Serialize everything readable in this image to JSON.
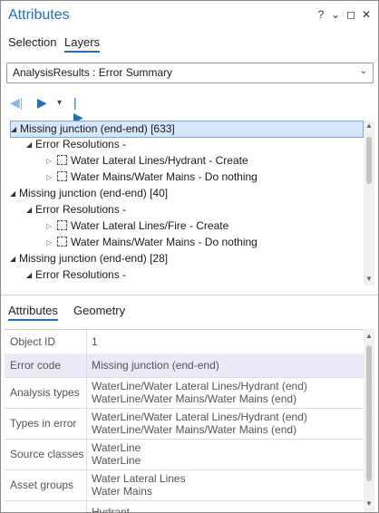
{
  "window": {
    "title": "Attributes",
    "help": "?",
    "menu": "⌄",
    "maximize": "◻",
    "close": "✕"
  },
  "top_tabs": [
    {
      "label": "Selection",
      "active": false
    },
    {
      "label": "Layers",
      "active": true
    }
  ],
  "layer_dropdown": {
    "value": "AnalysisResults : Error Summary",
    "chevron": "⌄"
  },
  "nav": {
    "first_icon": "◀|",
    "play_icon": "▶",
    "dropdown_icon": "▾",
    "last_icon": "|▶"
  },
  "tree": [
    {
      "text": "Missing junction (end-end) [633]",
      "level": 0,
      "expanded": true,
      "selected": true
    },
    {
      "text": "Error Resolutions -",
      "level": 1,
      "expanded": true
    },
    {
      "text": "Water Lateral Lines/Hydrant - Create",
      "level": 2,
      "expanded": false,
      "checkbox": true
    },
    {
      "text": "Water Mains/Water Mains - Do nothing",
      "level": 2,
      "expanded": false,
      "checkbox": true
    },
    {
      "text": "Missing junction (end-end) [40]",
      "level": 0,
      "expanded": true
    },
    {
      "text": "Error Resolutions -",
      "level": 1,
      "expanded": true
    },
    {
      "text": "Water Lateral Lines/Fire - Create",
      "level": 2,
      "expanded": false,
      "checkbox": true
    },
    {
      "text": "Water Mains/Water Mains - Do nothing",
      "level": 2,
      "expanded": false,
      "checkbox": true
    },
    {
      "text": "Missing junction (end-end) [28]",
      "level": 0,
      "expanded": true
    },
    {
      "text": "Error Resolutions -",
      "level": 1,
      "expanded": true
    }
  ],
  "bottom_tabs": [
    {
      "label": "Attributes",
      "active": true
    },
    {
      "label": "Geometry",
      "active": false
    }
  ],
  "attributes": [
    {
      "key": "Object ID",
      "lines": [
        "1"
      ]
    },
    {
      "key": "Error code",
      "lines": [
        "Missing junction (end-end)"
      ],
      "highlight": true
    },
    {
      "key": "Analysis types",
      "lines": [
        "WaterLine/Water Lateral Lines/Hydrant (end)",
        "WaterLine/Water Mains/Water Mains (end)"
      ]
    },
    {
      "key": "Types in error",
      "lines": [
        "WaterLine/Water Lateral Lines/Hydrant (end)",
        "WaterLine/Water Mains/Water Mains (end)"
      ]
    },
    {
      "key": "Source classes",
      "lines": [
        "WaterLine",
        "WaterLine"
      ]
    },
    {
      "key": "Asset groups",
      "lines": [
        "Water Lateral Lines",
        "Water Mains"
      ]
    },
    {
      "key": "",
      "lines": [
        "Hydrant"
      ]
    }
  ],
  "colors": {
    "accent": "#1f6fbf",
    "selected_row": "#d6e8fb",
    "highlight_row": "#ece8f6"
  }
}
